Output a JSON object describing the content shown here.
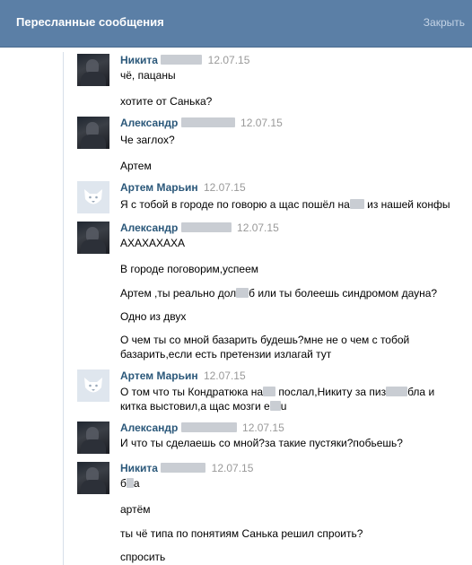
{
  "header": {
    "title": "Пересланные сообщения",
    "close_label": "Закрыть"
  },
  "colors": {
    "header_bg": "#5b7fa6",
    "author_link": "#2b587a",
    "date_gray": "#999999"
  },
  "messages": [
    {
      "author": "Никита",
      "date": "12.07.15",
      "lines": [
        "чё, пацаны",
        "хотите от Санька?"
      ]
    },
    {
      "author": "Александр",
      "date": "12.07.15",
      "lines": [
        "Че заглох?",
        "Артем"
      ]
    },
    {
      "author": "Артем Марьин",
      "date": "12.07.15",
      "lines": [
        "Я с тобой в городе по говорю а щас пошёл на",
        "из нашей конфы"
      ]
    },
    {
      "author": "Александр",
      "date": "12.07.15",
      "lines": [
        "АХАХАХАХА",
        "В городе поговорим,успеем",
        "Артем ,ты реально дол",
        "б или ты болеешь синдромом дауна?",
        "Одно из двух",
        "О чем ты со мной базарить будешь?мне не о чем с тобой",
        "базарить,если есть претензии излагай тут"
      ]
    },
    {
      "author": "Артем Марьин",
      "date": "12.07.15",
      "lines": [
        "О том что ты Кондратюка на",
        "послал,Никиту за пиз",
        "бла и",
        "китка выстовил,а щас мозги е",
        "u"
      ]
    },
    {
      "author": "Александр",
      "date": "12.07.15",
      "lines": [
        "И что ты сделаешь со мной?за такие пустяки?побьешь?"
      ]
    },
    {
      "author": "Никита",
      "date": "12.07.15",
      "lines": [
        "б",
        "а",
        "артём",
        "ты чё типа по понятиям Санька решил спроить?",
        "спросить"
      ]
    }
  ]
}
